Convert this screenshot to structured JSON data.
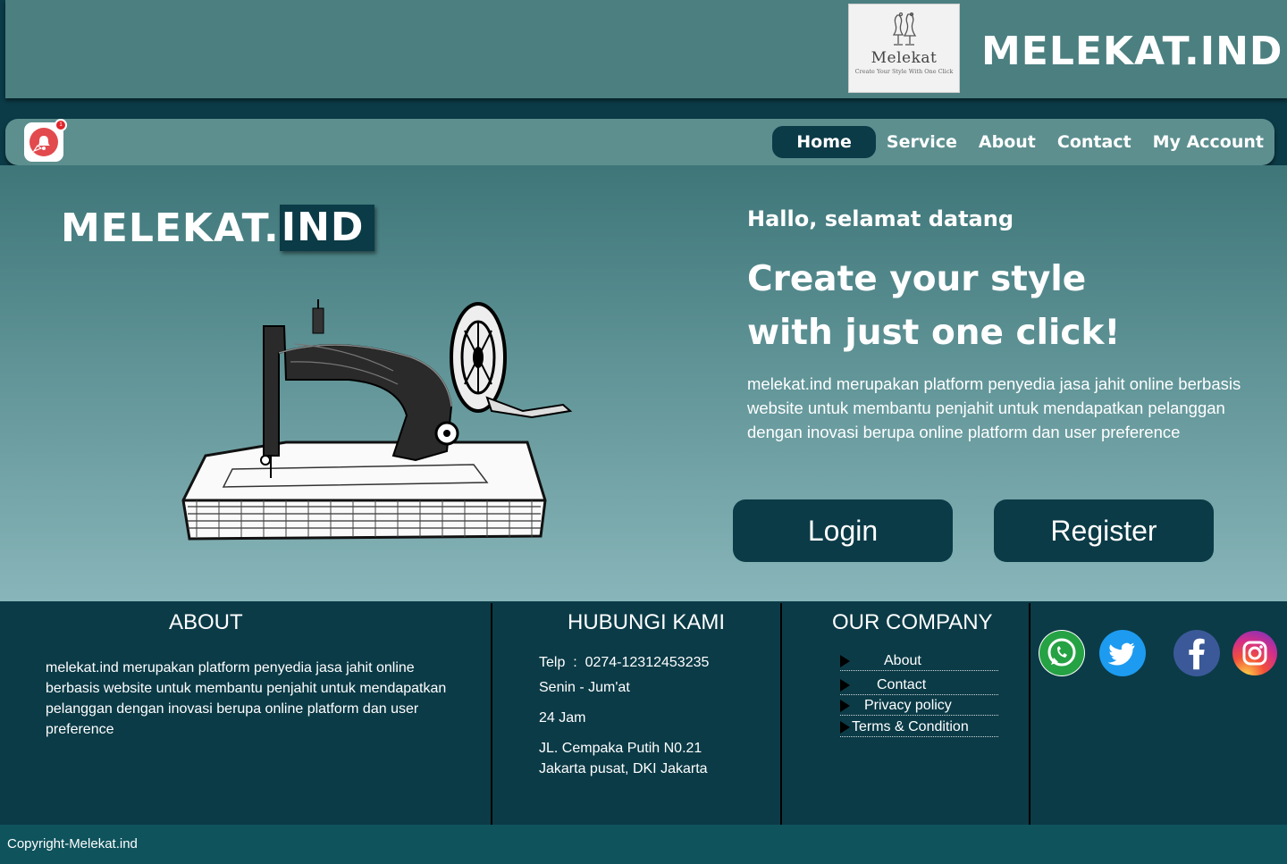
{
  "header": {
    "logo_name": "Melekat",
    "logo_tagline": "Create Your Style With One Click",
    "brand": "MELEKAT.IND"
  },
  "nav": {
    "notification_count": "1",
    "items": [
      {
        "label": "Home",
        "active": true
      },
      {
        "label": "Service"
      },
      {
        "label": "About"
      },
      {
        "label": "Contact"
      },
      {
        "label": "My Account"
      }
    ]
  },
  "hero": {
    "brand_part1": "MELEKAT.",
    "brand_part2": "IND",
    "greeting": "Hallo, selamat datang",
    "title_line1": "Create your style",
    "title_line2": "with just one click!",
    "description": "melekat.ind merupakan platform penyedia jasa jahit online berbasis website untuk membantu penjahit untuk mendapatkan pelanggan dengan inovasi berupa online platform dan user preference",
    "login_label": "Login",
    "register_label": "Register"
  },
  "footer": {
    "about_heading": "ABOUT",
    "about_text": "melekat.ind merupakan platform penyedia jasa jahit online berbasis website untuk membantu penjahit untuk mendapatkan pelanggan dengan inovasi berupa online platform dan user preference",
    "contact_heading": "HUBUNGI KAMI",
    "phone": "Telp  :  0274-12312453235",
    "days": "Senin - Jum'at",
    "hours": "24 Jam",
    "address_line1": "JL. Cempaka Putih N0.21",
    "address_line2": "Jakarta pusat, DKI Jakarta",
    "company_heading": "OUR COMPANY",
    "company_links": [
      "About",
      "Contact",
      "Privacy policy",
      "Terms & Condition"
    ],
    "social_icons": [
      "whatsapp-icon",
      "twitter-icon",
      "facebook-icon",
      "instagram-icon"
    ]
  },
  "copyright": "Copyright-Melekat.ind",
  "colors": {
    "header_bg": "#4b7f80",
    "nav_bg": "#5d8f8f",
    "dark_teal": "#0b3b47",
    "copyright_bg": "#0f535c"
  }
}
